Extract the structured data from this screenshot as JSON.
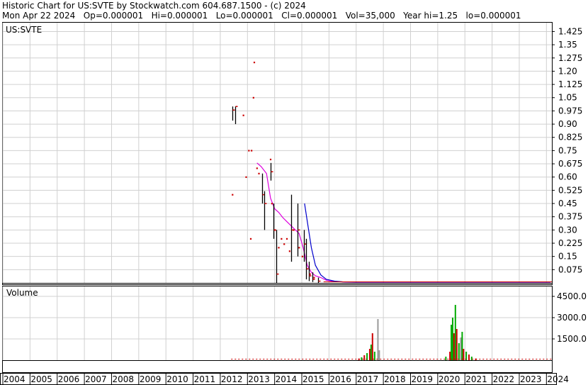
{
  "header": {
    "line1": "Historic Chart for US:SVTE by Stockwatch.com 604.687.1500 - (c) 2024",
    "line2": "Mon Apr 22 2024   Op=0.000001   Hi=0.000001   Lo=0.000001   Cl=0.000001   Vol=35,000   Year hi=1.25   lo=0.000001"
  },
  "colors": {
    "price_bar": "#000000",
    "price_dot": "#cc0000",
    "ma_short": "#dd00dd",
    "ma_long": "#0000cc",
    "vol_up": "#00aa00",
    "vol_down": "#cc0000",
    "vol_flat": "#999999",
    "grid": "#d0d0d0"
  },
  "chart_data": [
    {
      "type": "line",
      "title": "US:SVTE",
      "y_ticks": [
        "1.425",
        "1.35",
        "1.275",
        "1.20",
        "1.125",
        "1.05",
        "0.975",
        "0.90",
        "0.825",
        "0.75",
        "0.675",
        "0.60",
        "0.525",
        "0.45",
        "0.375",
        "0.30",
        "0.225",
        "0.15",
        "0.075"
      ],
      "ylim": [
        0,
        1.475
      ],
      "x_ticks": [
        "2004",
        "2005",
        "2006",
        "2007",
        "2008",
        "2009",
        "2010",
        "2011",
        "2012",
        "2013",
        "2014",
        "2015",
        "2016",
        "2017",
        "2018",
        "2019",
        "2020",
        "2021",
        "2022",
        "2023",
        "2024"
      ],
      "xlim": [
        2004,
        2024.2
      ],
      "grid": true,
      "bars": [
        {
          "x": 2012.45,
          "hi": 1.0,
          "lo": 0.92,
          "cl": 0.98
        },
        {
          "x": 2012.55,
          "hi": 1.0,
          "lo": 0.9,
          "cl": 1.0
        },
        {
          "x": 2013.55,
          "hi": 0.62,
          "lo": 0.45,
          "cl": 0.5
        },
        {
          "x": 2013.62,
          "hi": 0.52,
          "lo": 0.3,
          "cl": 0.45
        },
        {
          "x": 2013.85,
          "hi": 0.68,
          "lo": 0.58,
          "cl": 0.63
        },
        {
          "x": 2013.95,
          "hi": 0.45,
          "lo": 0.25,
          "cl": 0.3
        },
        {
          "x": 2014.05,
          "hi": 0.3,
          "lo": 0.0,
          "cl": 0.05
        },
        {
          "x": 2014.6,
          "hi": 0.5,
          "lo": 0.12,
          "cl": 0.3
        },
        {
          "x": 2014.85,
          "hi": 0.45,
          "lo": 0.15,
          "cl": 0.3
        },
        {
          "x": 2015.08,
          "hi": 0.3,
          "lo": 0.12,
          "cl": 0.22
        },
        {
          "x": 2015.15,
          "hi": 0.25,
          "lo": 0.02,
          "cl": 0.08
        },
        {
          "x": 2015.25,
          "hi": 0.12,
          "lo": 0.01,
          "cl": 0.04
        },
        {
          "x": 2015.4,
          "hi": 0.06,
          "lo": 0.005,
          "cl": 0.02
        },
        {
          "x": 2015.6,
          "hi": 0.03,
          "lo": 0.0,
          "cl": 0.01
        }
      ],
      "dots": [
        {
          "x": 2012.45,
          "y": 0.5
        },
        {
          "x": 2012.85,
          "y": 0.95
        },
        {
          "x": 2012.95,
          "y": 0.6
        },
        {
          "x": 2013.05,
          "y": 0.75
        },
        {
          "x": 2013.12,
          "y": 0.25
        },
        {
          "x": 2013.15,
          "y": 0.75
        },
        {
          "x": 2013.22,
          "y": 1.05
        },
        {
          "x": 2013.25,
          "y": 1.25
        },
        {
          "x": 2013.35,
          "y": 0.65
        },
        {
          "x": 2013.42,
          "y": 0.62
        },
        {
          "x": 2013.85,
          "y": 0.7
        },
        {
          "x": 2013.9,
          "y": 0.45
        },
        {
          "x": 2014.02,
          "y": 0.3
        },
        {
          "x": 2014.15,
          "y": 0.2
        },
        {
          "x": 2014.25,
          "y": 0.25
        },
        {
          "x": 2014.35,
          "y": 0.22
        },
        {
          "x": 2014.45,
          "y": 0.25
        },
        {
          "x": 2014.55,
          "y": 0.18
        },
        {
          "x": 2014.7,
          "y": 0.3
        },
        {
          "x": 2014.9,
          "y": 0.2
        },
        {
          "x": 2015.02,
          "y": 0.15
        },
        {
          "x": 2015.3,
          "y": 0.05
        },
        {
          "x": 2015.45,
          "y": 0.03
        }
      ],
      "series": [
        {
          "color_key": "ma_short",
          "x": [
            2013.35,
            2013.5,
            2013.7,
            2013.85,
            2014.0,
            2014.15,
            2014.3,
            2014.5,
            2014.7,
            2014.9,
            2015.05,
            2015.2,
            2015.35,
            2015.5,
            2015.7,
            2015.9,
            2016.2,
            2016.6,
            2017.0,
            2018.0,
            2019.0,
            2020.0,
            2021.0,
            2022.0,
            2023.0,
            2024.15
          ],
          "values": [
            0.68,
            0.66,
            0.62,
            0.48,
            0.42,
            0.4,
            0.37,
            0.34,
            0.31,
            0.28,
            0.2,
            0.1,
            0.06,
            0.04,
            0.03,
            0.015,
            0.008,
            0.005,
            0.004,
            0.004,
            0.004,
            0.004,
            0.004,
            0.004,
            0.004,
            0.004
          ]
        },
        {
          "color_key": "ma_long",
          "x": [
            2015.1,
            2015.2,
            2015.35,
            2015.5,
            2015.7,
            2015.9,
            2016.2,
            2016.5,
            2017.0,
            2018.0,
            2019.0,
            2020.0,
            2021.0,
            2022.0,
            2023.0,
            2024.15
          ],
          "values": [
            0.45,
            0.35,
            0.2,
            0.1,
            0.045,
            0.02,
            0.01,
            0.006,
            0.005,
            0.005,
            0.005,
            0.005,
            0.005,
            0.005,
            0.005,
            0.005
          ]
        }
      ]
    },
    {
      "type": "bar",
      "title": "Volume",
      "y_ticks": [
        "4500.0",
        "3000.0",
        "1500.0"
      ],
      "ylim": [
        0,
        5200
      ],
      "xlim": [
        2004,
        2024.2
      ],
      "volumes": [
        {
          "x": 2017.1,
          "v": 120,
          "c": "vol_down"
        },
        {
          "x": 2017.2,
          "v": 200,
          "c": "vol_up"
        },
        {
          "x": 2017.3,
          "v": 350,
          "c": "vol_down"
        },
        {
          "x": 2017.4,
          "v": 500,
          "c": "vol_up"
        },
        {
          "x": 2017.5,
          "v": 800,
          "c": "vol_down"
        },
        {
          "x": 2017.55,
          "v": 1100,
          "c": "vol_up"
        },
        {
          "x": 2017.6,
          "v": 1900,
          "c": "vol_down"
        },
        {
          "x": 2017.68,
          "v": 600,
          "c": "vol_up"
        },
        {
          "x": 2017.8,
          "v": 2900,
          "c": "vol_flat"
        },
        {
          "x": 2017.85,
          "v": 700,
          "c": "vol_flat"
        },
        {
          "x": 2020.3,
          "v": 250,
          "c": "vol_up"
        },
        {
          "x": 2020.45,
          "v": 600,
          "c": "vol_down"
        },
        {
          "x": 2020.5,
          "v": 2500,
          "c": "vol_up"
        },
        {
          "x": 2020.55,
          "v": 3000,
          "c": "vol_up"
        },
        {
          "x": 2020.6,
          "v": 1900,
          "c": "vol_down"
        },
        {
          "x": 2020.65,
          "v": 3900,
          "c": "vol_up"
        },
        {
          "x": 2020.7,
          "v": 2200,
          "c": "vol_down"
        },
        {
          "x": 2020.78,
          "v": 1200,
          "c": "vol_up"
        },
        {
          "x": 2020.85,
          "v": 1600,
          "c": "vol_flat"
        },
        {
          "x": 2020.9,
          "v": 2000,
          "c": "vol_up"
        },
        {
          "x": 2020.95,
          "v": 800,
          "c": "vol_down"
        },
        {
          "x": 2021.05,
          "v": 600,
          "c": "vol_up"
        },
        {
          "x": 2021.15,
          "v": 400,
          "c": "vol_down"
        },
        {
          "x": 2021.25,
          "v": 250,
          "c": "vol_up"
        },
        {
          "x": 2021.4,
          "v": 120,
          "c": "vol_down"
        }
      ]
    }
  ]
}
